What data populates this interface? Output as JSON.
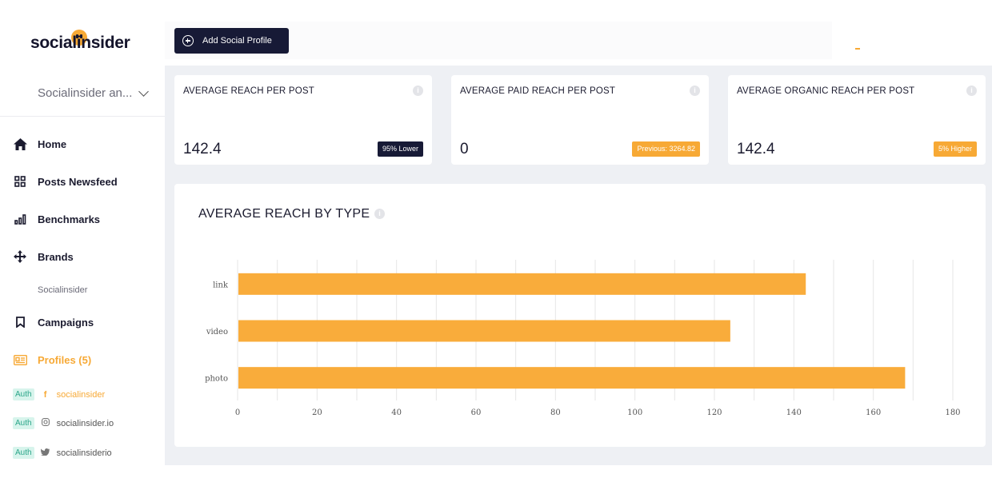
{
  "app": {
    "logo_text": "socialinsider",
    "brand_selector": "Socialinsider an...",
    "add_profile_label": "Add Social Profile"
  },
  "sidebar": {
    "items": [
      {
        "label": "Home",
        "icon": "home-icon"
      },
      {
        "label": "Posts Newsfeed",
        "icon": "grid-icon"
      },
      {
        "label": "Benchmarks",
        "icon": "bar-chart-icon"
      },
      {
        "label": "Brands",
        "icon": "move-icon"
      },
      {
        "label": "Campaigns",
        "icon": "bookmark-icon"
      },
      {
        "label": "Profiles (5)",
        "icon": "profile-card-icon"
      }
    ],
    "brands_sub": "Socialinsider",
    "profiles": [
      {
        "auth": "Auth",
        "network_icon": "facebook-icon",
        "name": "socialinsider"
      },
      {
        "auth": "Auth",
        "network_icon": "instagram-icon",
        "name": "socialinsider.io"
      },
      {
        "auth": "Auth",
        "network_icon": "twitter-icon",
        "name": "socialinsiderio"
      }
    ],
    "active_color": "#f7a935"
  },
  "cards": [
    {
      "title": "AVERAGE REACH PER POST",
      "value": "142.4",
      "badge": "95% Lower",
      "badge_color": "#171a36"
    },
    {
      "title": "AVERAGE PAID REACH PER POST",
      "value": "0",
      "badge": "Previous: 3264.82",
      "badge_color": "#f7a935"
    },
    {
      "title": "AVERAGE ORGANIC REACH PER POST",
      "value": "142.4",
      "badge": "5% Higher",
      "badge_color": "#f7a935"
    }
  ],
  "chart_data": {
    "type": "bar",
    "orientation": "horizontal",
    "title": "AVERAGE REACH BY TYPE",
    "categories": [
      "link",
      "video",
      "photo"
    ],
    "values": [
      143,
      124,
      168
    ],
    "xlim": [
      0,
      180
    ],
    "xticks": [
      0,
      20,
      40,
      60,
      80,
      100,
      120,
      140,
      160,
      180
    ],
    "grid": true,
    "bar_color": "#f9ac3b"
  }
}
